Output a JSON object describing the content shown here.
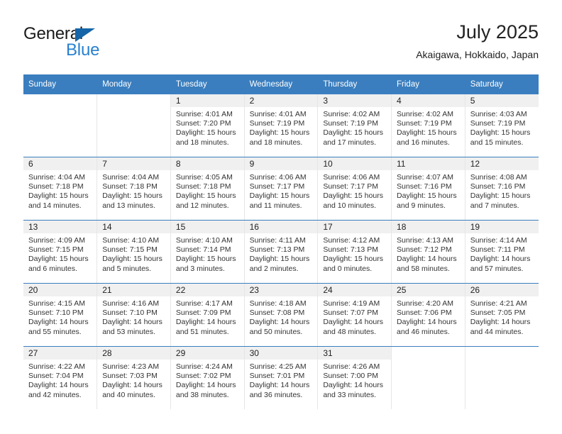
{
  "brand": {
    "name_top": "General",
    "name_bottom": "Blue",
    "triangle_color": "#1565a8",
    "blue_color": "#2980d0"
  },
  "header": {
    "title": "July 2025",
    "subtitle": "Akaigawa, Hokkaido, Japan"
  },
  "theme": {
    "header_blue": "#3a7ebf",
    "daynum_band": "#f0f0f0",
    "cell_divider": "#e6e6e6"
  },
  "weekday_headers": [
    "Sunday",
    "Monday",
    "Tuesday",
    "Wednesday",
    "Thursday",
    "Friday",
    "Saturday"
  ],
  "labels": {
    "sunrise_prefix": "Sunrise: ",
    "sunset_prefix": "Sunset: ",
    "daylight_prefix": "Daylight: "
  },
  "weeks": [
    [
      {
        "day": "",
        "sunrise": "",
        "sunset": "",
        "daylight": ""
      },
      {
        "day": "",
        "sunrise": "",
        "sunset": "",
        "daylight": ""
      },
      {
        "day": "1",
        "sunrise": "Sunrise: 4:01 AM",
        "sunset": "Sunset: 7:20 PM",
        "daylight": "Daylight: 15 hours and 18 minutes."
      },
      {
        "day": "2",
        "sunrise": "Sunrise: 4:01 AM",
        "sunset": "Sunset: 7:19 PM",
        "daylight": "Daylight: 15 hours and 18 minutes."
      },
      {
        "day": "3",
        "sunrise": "Sunrise: 4:02 AM",
        "sunset": "Sunset: 7:19 PM",
        "daylight": "Daylight: 15 hours and 17 minutes."
      },
      {
        "day": "4",
        "sunrise": "Sunrise: 4:02 AM",
        "sunset": "Sunset: 7:19 PM",
        "daylight": "Daylight: 15 hours and 16 minutes."
      },
      {
        "day": "5",
        "sunrise": "Sunrise: 4:03 AM",
        "sunset": "Sunset: 7:19 PM",
        "daylight": "Daylight: 15 hours and 15 minutes."
      }
    ],
    [
      {
        "day": "6",
        "sunrise": "Sunrise: 4:04 AM",
        "sunset": "Sunset: 7:18 PM",
        "daylight": "Daylight: 15 hours and 14 minutes."
      },
      {
        "day": "7",
        "sunrise": "Sunrise: 4:04 AM",
        "sunset": "Sunset: 7:18 PM",
        "daylight": "Daylight: 15 hours and 13 minutes."
      },
      {
        "day": "8",
        "sunrise": "Sunrise: 4:05 AM",
        "sunset": "Sunset: 7:18 PM",
        "daylight": "Daylight: 15 hours and 12 minutes."
      },
      {
        "day": "9",
        "sunrise": "Sunrise: 4:06 AM",
        "sunset": "Sunset: 7:17 PM",
        "daylight": "Daylight: 15 hours and 11 minutes."
      },
      {
        "day": "10",
        "sunrise": "Sunrise: 4:06 AM",
        "sunset": "Sunset: 7:17 PM",
        "daylight": "Daylight: 15 hours and 10 minutes."
      },
      {
        "day": "11",
        "sunrise": "Sunrise: 4:07 AM",
        "sunset": "Sunset: 7:16 PM",
        "daylight": "Daylight: 15 hours and 9 minutes."
      },
      {
        "day": "12",
        "sunrise": "Sunrise: 4:08 AM",
        "sunset": "Sunset: 7:16 PM",
        "daylight": "Daylight: 15 hours and 7 minutes."
      }
    ],
    [
      {
        "day": "13",
        "sunrise": "Sunrise: 4:09 AM",
        "sunset": "Sunset: 7:15 PM",
        "daylight": "Daylight: 15 hours and 6 minutes."
      },
      {
        "day": "14",
        "sunrise": "Sunrise: 4:10 AM",
        "sunset": "Sunset: 7:15 PM",
        "daylight": "Daylight: 15 hours and 5 minutes."
      },
      {
        "day": "15",
        "sunrise": "Sunrise: 4:10 AM",
        "sunset": "Sunset: 7:14 PM",
        "daylight": "Daylight: 15 hours and 3 minutes."
      },
      {
        "day": "16",
        "sunrise": "Sunrise: 4:11 AM",
        "sunset": "Sunset: 7:13 PM",
        "daylight": "Daylight: 15 hours and 2 minutes."
      },
      {
        "day": "17",
        "sunrise": "Sunrise: 4:12 AM",
        "sunset": "Sunset: 7:13 PM",
        "daylight": "Daylight: 15 hours and 0 minutes."
      },
      {
        "day": "18",
        "sunrise": "Sunrise: 4:13 AM",
        "sunset": "Sunset: 7:12 PM",
        "daylight": "Daylight: 14 hours and 58 minutes."
      },
      {
        "day": "19",
        "sunrise": "Sunrise: 4:14 AM",
        "sunset": "Sunset: 7:11 PM",
        "daylight": "Daylight: 14 hours and 57 minutes."
      }
    ],
    [
      {
        "day": "20",
        "sunrise": "Sunrise: 4:15 AM",
        "sunset": "Sunset: 7:10 PM",
        "daylight": "Daylight: 14 hours and 55 minutes."
      },
      {
        "day": "21",
        "sunrise": "Sunrise: 4:16 AM",
        "sunset": "Sunset: 7:10 PM",
        "daylight": "Daylight: 14 hours and 53 minutes."
      },
      {
        "day": "22",
        "sunrise": "Sunrise: 4:17 AM",
        "sunset": "Sunset: 7:09 PM",
        "daylight": "Daylight: 14 hours and 51 minutes."
      },
      {
        "day": "23",
        "sunrise": "Sunrise: 4:18 AM",
        "sunset": "Sunset: 7:08 PM",
        "daylight": "Daylight: 14 hours and 50 minutes."
      },
      {
        "day": "24",
        "sunrise": "Sunrise: 4:19 AM",
        "sunset": "Sunset: 7:07 PM",
        "daylight": "Daylight: 14 hours and 48 minutes."
      },
      {
        "day": "25",
        "sunrise": "Sunrise: 4:20 AM",
        "sunset": "Sunset: 7:06 PM",
        "daylight": "Daylight: 14 hours and 46 minutes."
      },
      {
        "day": "26",
        "sunrise": "Sunrise: 4:21 AM",
        "sunset": "Sunset: 7:05 PM",
        "daylight": "Daylight: 14 hours and 44 minutes."
      }
    ],
    [
      {
        "day": "27",
        "sunrise": "Sunrise: 4:22 AM",
        "sunset": "Sunset: 7:04 PM",
        "daylight": "Daylight: 14 hours and 42 minutes."
      },
      {
        "day": "28",
        "sunrise": "Sunrise: 4:23 AM",
        "sunset": "Sunset: 7:03 PM",
        "daylight": "Daylight: 14 hours and 40 minutes."
      },
      {
        "day": "29",
        "sunrise": "Sunrise: 4:24 AM",
        "sunset": "Sunset: 7:02 PM",
        "daylight": "Daylight: 14 hours and 38 minutes."
      },
      {
        "day": "30",
        "sunrise": "Sunrise: 4:25 AM",
        "sunset": "Sunset: 7:01 PM",
        "daylight": "Daylight: 14 hours and 36 minutes."
      },
      {
        "day": "31",
        "sunrise": "Sunrise: 4:26 AM",
        "sunset": "Sunset: 7:00 PM",
        "daylight": "Daylight: 14 hours and 33 minutes."
      },
      {
        "day": "",
        "sunrise": "",
        "sunset": "",
        "daylight": ""
      },
      {
        "day": "",
        "sunrise": "",
        "sunset": "",
        "daylight": ""
      }
    ]
  ]
}
